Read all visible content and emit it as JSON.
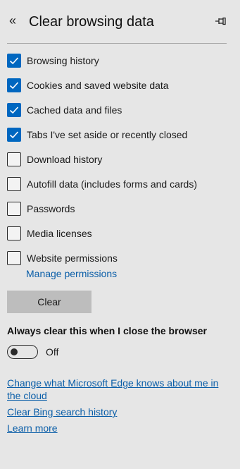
{
  "header": {
    "title": "Clear browsing data",
    "back_icon": "double-chevron-left",
    "pin_icon": "pin"
  },
  "options": [
    {
      "label": "Browsing history",
      "checked": true
    },
    {
      "label": "Cookies and saved website data",
      "checked": true
    },
    {
      "label": "Cached data and files",
      "checked": true
    },
    {
      "label": "Tabs I've set aside or recently closed",
      "checked": true
    },
    {
      "label": "Download history",
      "checked": false
    },
    {
      "label": "Autofill data (includes forms and cards)",
      "checked": false
    },
    {
      "label": "Passwords",
      "checked": false
    },
    {
      "label": "Media licenses",
      "checked": false
    },
    {
      "label": "Website permissions",
      "checked": false
    }
  ],
  "manage_permissions_link": "Manage permissions",
  "clear_button": "Clear",
  "always_clear": {
    "heading": "Always clear this when I close the browser",
    "toggle_state": "Off",
    "enabled": false
  },
  "links": {
    "cloud": "Change what Microsoft Edge knows about me in the cloud",
    "bing": "Clear Bing search history",
    "learn_more": "Learn more"
  },
  "colors": {
    "accent": "#0067c0",
    "link": "#0a5ea8",
    "background": "#e6e6e6",
    "button": "#bdbdbd"
  }
}
